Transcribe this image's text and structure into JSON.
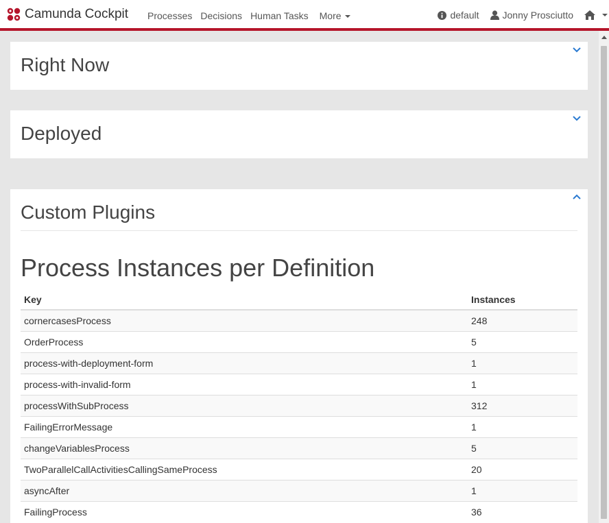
{
  "header": {
    "brand": "Camunda Cockpit",
    "nav": [
      "Processes",
      "Decisions",
      "Human Tasks"
    ],
    "more_label": "More",
    "engine_label": "default",
    "user_label": "Jonny Prosciutto",
    "accent_color": "#b5152b"
  },
  "panels": {
    "right_now": {
      "title": "Right Now",
      "toggle_icon": "chevron-down-icon"
    },
    "deployed": {
      "title": "Deployed",
      "toggle_icon": "chevron-down-icon"
    },
    "custom_plugins": {
      "title": "Custom Plugins",
      "toggle_icon": "chevron-up-icon"
    }
  },
  "plugin": {
    "title": "Process Instances per Definition",
    "columns": [
      "Key",
      "Instances"
    ],
    "rows": [
      [
        "cornercasesProcess",
        "248"
      ],
      [
        "OrderProcess",
        "5"
      ],
      [
        "process-with-deployment-form",
        "1"
      ],
      [
        "process-with-invalid-form",
        "1"
      ],
      [
        "processWithSubProcess",
        "312"
      ],
      [
        "FailingErrorMessage",
        "1"
      ],
      [
        "changeVariablesProcess",
        "5"
      ],
      [
        "TwoParallelCallActivitiesCallingSameProcess",
        "20"
      ],
      [
        "asyncAfter",
        "1"
      ],
      [
        "FailingProcess",
        "36"
      ]
    ]
  }
}
